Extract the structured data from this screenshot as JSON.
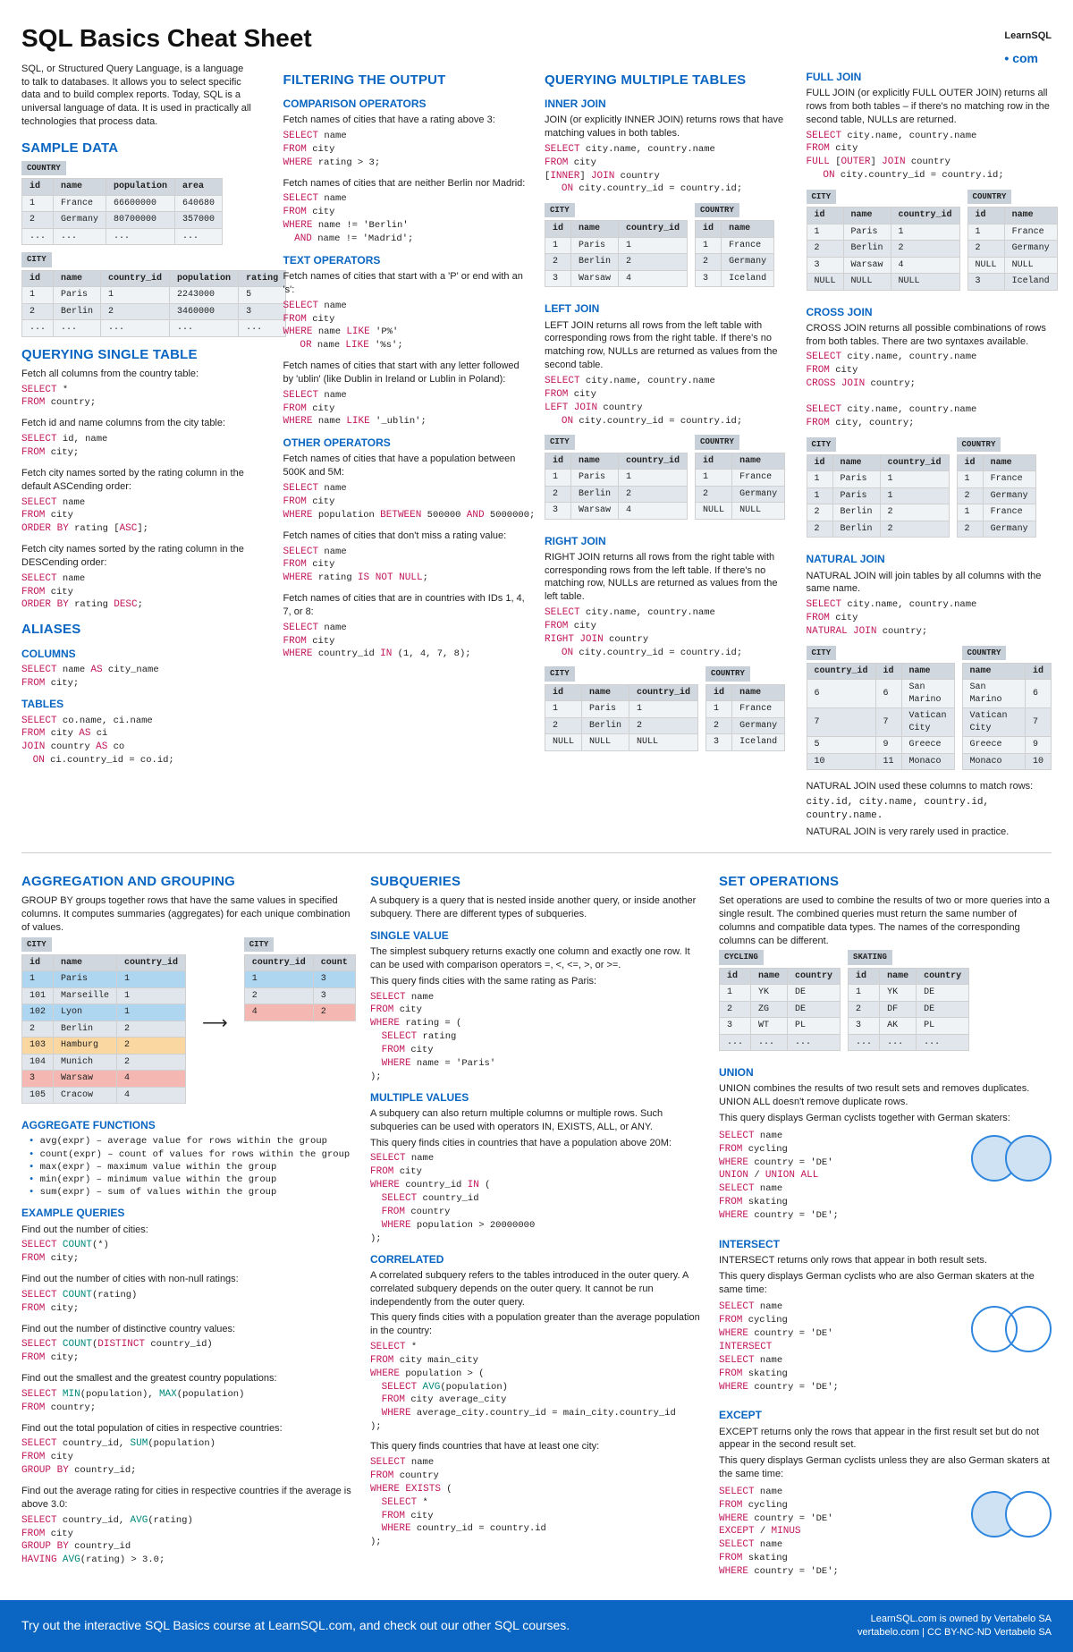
{
  "title": "SQL Basics Cheat Sheet",
  "logo": {
    "brand": "LearnSQL",
    "suffix": "• com"
  },
  "intro": "SQL, or Structured Query Language, is a language to talk to databases. It allows you to select specific data and to build complex reports. Today, SQL is a universal language of data. It is used in practically all technologies that process data.",
  "sample": {
    "h": "SAMPLE DATA",
    "country": {
      "label": "COUNTRY",
      "head": [
        "id",
        "name",
        "population",
        "area"
      ],
      "rows": [
        [
          "1",
          "France",
          "66600000",
          "640680"
        ],
        [
          "2",
          "Germany",
          "80700000",
          "357000"
        ],
        [
          "...",
          "...",
          "...",
          "..."
        ]
      ]
    },
    "city": {
      "label": "CITY",
      "head": [
        "id",
        "name",
        "country_id",
        "population",
        "rating"
      ],
      "rows": [
        [
          "1",
          "Paris",
          "1",
          "2243000",
          "5"
        ],
        [
          "2",
          "Berlin",
          "2",
          "3460000",
          "3"
        ],
        [
          "...",
          "...",
          "...",
          "...",
          "..."
        ]
      ]
    }
  },
  "single": {
    "h": "QUERYING SINGLE TABLE",
    "t1": "Fetch all columns from the country table:",
    "c1": "SELECT *\nFROM country;",
    "t2": "Fetch id and name columns from the city table:",
    "c2": "SELECT id, name\nFROM city;",
    "t3": "Fetch city names sorted by the rating column in the default ASCending order:",
    "c3": "SELECT name\nFROM city\nORDER BY rating [ASC];",
    "t4": "Fetch city names sorted by the rating column in the DESCending order:",
    "c4": "SELECT name\nFROM city\nORDER BY rating DESC;"
  },
  "aliases": {
    "h": "ALIASES",
    "h_cols": "COLUMNS",
    "c1": "SELECT name AS city_name\nFROM city;",
    "h_tab": "TABLES",
    "c2": "SELECT co.name, ci.name\nFROM city AS ci\nJOIN country AS co\n  ON ci.country_id = co.id;"
  },
  "filter": {
    "h": "FILTERING THE OUTPUT",
    "h_comp": "COMPARISON OPERATORS",
    "t1": "Fetch names of cities that have a rating above 3:",
    "c1": "SELECT name\nFROM city\nWHERE rating > 3;",
    "t2": "Fetch names of cities that are neither Berlin nor Madrid:",
    "c2": "SELECT name\nFROM city\nWHERE name != 'Berlin'\n  AND name != 'Madrid';",
    "h_text": "TEXT OPERATORS",
    "t3": "Fetch names of cities that start with a 'P' or end with an 's':",
    "c3": "SELECT name\nFROM city\nWHERE name LIKE 'P%'\n   OR name LIKE '%s';",
    "t4": "Fetch names of cities that start with any letter followed by 'ublin' (like Dublin in Ireland or Lublin in Poland):",
    "c4": "SELECT name\nFROM city\nWHERE name LIKE '_ublin';",
    "h_other": "OTHER OPERATORS",
    "t5": "Fetch names of cities that have a population between 500K and 5M:",
    "c5": "SELECT name\nFROM city\nWHERE population BETWEEN 500000 AND 5000000;",
    "t6": "Fetch names of cities that don't miss a rating value:",
    "c6": "SELECT name\nFROM city\nWHERE rating IS NOT NULL;",
    "t7": "Fetch names of cities that are in countries with IDs 1, 4, 7, or 8:",
    "c7": "SELECT name\nFROM city\nWHERE country_id IN (1, 4, 7, 8);"
  },
  "multi": {
    "h": "QUERYING MULTIPLE TABLES",
    "inner": {
      "h": "INNER JOIN",
      "t": "JOIN (or explicitly INNER JOIN) returns rows that have matching values in both tables.",
      "c": "SELECT city.name, country.name\nFROM city\n[INNER] JOIN country\n   ON city.country_id = country.id;",
      "tbl1": {
        "label": "CITY",
        "head": [
          "id",
          "name",
          "country_id"
        ],
        "rows": [
          [
            "1",
            "Paris",
            "1"
          ],
          [
            "2",
            "Berlin",
            "2"
          ],
          [
            "3",
            "Warsaw",
            "4"
          ]
        ]
      },
      "tbl2": {
        "label": "COUNTRY",
        "head": [
          "id",
          "name"
        ],
        "rows": [
          [
            "1",
            "France"
          ],
          [
            "2",
            "Germany"
          ],
          [
            "3",
            "Iceland"
          ]
        ]
      }
    },
    "left": {
      "h": "LEFT JOIN",
      "t": "LEFT JOIN returns all rows from the left table with corresponding rows from the right table. If there's no matching row, NULLs are returned as values from the second table.",
      "c": "SELECT city.name, country.name\nFROM city\nLEFT JOIN country\n   ON city.country_id = country.id;",
      "tbl1": {
        "label": "CITY",
        "head": [
          "id",
          "name",
          "country_id"
        ],
        "rows": [
          [
            "1",
            "Paris",
            "1"
          ],
          [
            "2",
            "Berlin",
            "2"
          ],
          [
            "3",
            "Warsaw",
            "4"
          ]
        ]
      },
      "tbl2": {
        "label": "COUNTRY",
        "head": [
          "id",
          "name"
        ],
        "rows": [
          [
            "1",
            "France"
          ],
          [
            "2",
            "Germany"
          ],
          [
            "NULL",
            "NULL"
          ]
        ]
      }
    },
    "right": {
      "h": "RIGHT JOIN",
      "t": "RIGHT JOIN returns all rows from the right table with corresponding rows from the left table. If there's no matching row, NULLs are returned as values from the left table.",
      "c": "SELECT city.name, country.name\nFROM city\nRIGHT JOIN country\n   ON city.country_id = country.id;",
      "tbl1": {
        "label": "CITY",
        "head": [
          "id",
          "name",
          "country_id"
        ],
        "rows": [
          [
            "1",
            "Paris",
            "1"
          ],
          [
            "2",
            "Berlin",
            "2"
          ],
          [
            "NULL",
            "NULL",
            "NULL"
          ]
        ]
      },
      "tbl2": {
        "label": "COUNTRY",
        "head": [
          "id",
          "name"
        ],
        "rows": [
          [
            "1",
            "France"
          ],
          [
            "2",
            "Germany"
          ],
          [
            "3",
            "Iceland"
          ]
        ]
      }
    }
  },
  "joins2": {
    "full": {
      "h": "FULL JOIN",
      "t": "FULL JOIN (or explicitly FULL OUTER JOIN) returns all rows from both tables – if there's no matching row in the second table, NULLs are returned.",
      "c": "SELECT city.name, country.name\nFROM city\nFULL [OUTER] JOIN country\n   ON city.country_id = country.id;",
      "tbl1": {
        "label": "CITY",
        "head": [
          "id",
          "name",
          "country_id"
        ],
        "rows": [
          [
            "1",
            "Paris",
            "1"
          ],
          [
            "2",
            "Berlin",
            "2"
          ],
          [
            "3",
            "Warsaw",
            "4"
          ],
          [
            "NULL",
            "NULL",
            "NULL"
          ]
        ]
      },
      "tbl2": {
        "label": "COUNTRY",
        "head": [
          "id",
          "name"
        ],
        "rows": [
          [
            "1",
            "France"
          ],
          [
            "2",
            "Germany"
          ],
          [
            "NULL",
            "NULL"
          ],
          [
            "3",
            "Iceland"
          ]
        ]
      }
    },
    "cross": {
      "h": "CROSS JOIN",
      "t": "CROSS JOIN returns all possible combinations of rows from both tables. There are two syntaxes available.",
      "c": "SELECT city.name, country.name\nFROM city\nCROSS JOIN country;\n\nSELECT city.name, country.name\nFROM city, country;",
      "tbl1": {
        "label": "CITY",
        "head": [
          "id",
          "name",
          "country_id"
        ],
        "rows": [
          [
            "1",
            "Paris",
            "1"
          ],
          [
            "1",
            "Paris",
            "1"
          ],
          [
            "2",
            "Berlin",
            "2"
          ],
          [
            "2",
            "Berlin",
            "2"
          ]
        ]
      },
      "tbl2": {
        "label": "COUNTRY",
        "head": [
          "id",
          "name"
        ],
        "rows": [
          [
            "1",
            "France"
          ],
          [
            "2",
            "Germany"
          ],
          [
            "1",
            "France"
          ],
          [
            "2",
            "Germany"
          ]
        ]
      }
    },
    "natural": {
      "h": "NATURAL JOIN",
      "t": "NATURAL JOIN will join tables by all columns with the same name.",
      "c": "SELECT city.name, country.name\nFROM city\nNATURAL JOIN country;",
      "tbl1": {
        "label": "CITY",
        "head": [
          "country_id",
          "id",
          "name"
        ],
        "rows": [
          [
            "6",
            "6",
            "San Marino"
          ],
          [
            "7",
            "7",
            "Vatican City"
          ],
          [
            "5",
            "9",
            "Greece"
          ],
          [
            "10",
            "11",
            "Monaco"
          ]
        ]
      },
      "tbl2": {
        "label": "COUNTRY",
        "head": [
          "name",
          "id"
        ],
        "rows": [
          [
            "San Marino",
            "6"
          ],
          [
            "Vatican City",
            "7"
          ],
          [
            "Greece",
            "9"
          ],
          [
            "Monaco",
            "10"
          ]
        ]
      },
      "note1": "NATURAL JOIN used these columns to match rows:",
      "note2": "city.id, city.name, country.id, country.name.",
      "note3": "NATURAL JOIN is very rarely used in practice."
    }
  },
  "agg": {
    "h": "AGGREGATION AND GROUPING",
    "t": "GROUP BY groups together rows that have the same values in specified columns. It computes summaries (aggregates) for each unique combination of values.",
    "tbl1": {
      "label": "CITY",
      "head": [
        "id",
        "name",
        "country_id"
      ],
      "rows": [
        [
          "1",
          "Paris",
          "1"
        ],
        [
          "101",
          "Marseille",
          "1"
        ],
        [
          "102",
          "Lyon",
          "1"
        ],
        [
          "2",
          "Berlin",
          "2"
        ],
        [
          "103",
          "Hamburg",
          "2"
        ],
        [
          "104",
          "Munich",
          "2"
        ],
        [
          "3",
          "Warsaw",
          "4"
        ],
        [
          "105",
          "Cracow",
          "4"
        ]
      ]
    },
    "tbl2": {
      "label": "CITY",
      "head": [
        "country_id",
        "count"
      ],
      "rows": [
        [
          "1",
          "3"
        ],
        [
          "2",
          "3"
        ],
        [
          "4",
          "2"
        ]
      ]
    },
    "h_fn": "AGGREGATE FUNCTIONS",
    "fns": [
      "avg(expr) – average value for rows within the group",
      "count(expr) – count of values for rows within the group",
      "max(expr) – maximum value within the group",
      "min(expr) – minimum value within the group",
      "sum(expr) – sum of values within the group"
    ],
    "h_ex": "EXAMPLE QUERIES",
    "e1t": "Find out the number of cities:",
    "e1c": "SELECT COUNT(*)\nFROM city;",
    "e2t": "Find out the number of cities with non-null ratings:",
    "e2c": "SELECT COUNT(rating)\nFROM city;",
    "e3t": "Find out the number of distinctive country values:",
    "e3c": "SELECT COUNT(DISTINCT country_id)\nFROM city;",
    "e4t": "Find out the smallest and the greatest country populations:",
    "e4c": "SELECT MIN(population), MAX(population)\nFROM country;",
    "e5t": "Find out the total population of cities in respective countries:",
    "e5c": "SELECT country_id, SUM(population)\nFROM city\nGROUP BY country_id;",
    "e6t": "Find out the average rating for cities in respective countries if the average is above 3.0:",
    "e6c": "SELECT country_id, AVG(rating)\nFROM city\nGROUP BY country_id\nHAVING AVG(rating) > 3.0;"
  },
  "subq": {
    "h": "SUBQUERIES",
    "t": "A subquery is a query that is nested inside another query, or inside another subquery. There are different types of subqueries.",
    "sv": {
      "h": "SINGLE VALUE",
      "t": "The simplest subquery returns exactly one column and exactly one row. It can be used with comparison operators =, <, <=, >, or >=.",
      "t2": "This query finds cities with the same rating as Paris:",
      "c": "SELECT name\nFROM city\nWHERE rating = (\n  SELECT rating\n  FROM city\n  WHERE name = 'Paris'\n);"
    },
    "mv": {
      "h": "MULTIPLE VALUES",
      "t": "A subquery can also return multiple columns or multiple rows. Such subqueries can be used with operators IN, EXISTS, ALL, or ANY.",
      "t2": "This query finds cities in countries that have a population above 20M:",
      "c": "SELECT name\nFROM city\nWHERE country_id IN (\n  SELECT country_id\n  FROM country\n  WHERE population > 20000000\n);"
    },
    "co": {
      "h": "CORRELATED",
      "t": "A correlated subquery refers to the tables introduced in the outer query. A correlated subquery depends on the outer query. It cannot be run independently from the outer query.",
      "t2": "This query finds cities with a population greater than the average population in the country:",
      "c": "SELECT *\nFROM city main_city\nWHERE population > (\n  SELECT AVG(population)\n  FROM city average_city\n  WHERE average_city.country_id = main_city.country_id\n);",
      "t3": "This query finds countries that have at least one city:",
      "c2": "SELECT name\nFROM country\nWHERE EXISTS (\n  SELECT *\n  FROM city\n  WHERE country_id = country.id\n);"
    }
  },
  "setops": {
    "h": "SET OPERATIONS",
    "t": "Set operations are used to combine the results of two or more queries into a single result. The combined queries must return the same number of columns and compatible data types. The names of the corresponding columns can be different.",
    "cyc": {
      "label": "CYCLING",
      "head": [
        "id",
        "name",
        "country"
      ],
      "rows": [
        [
          "1",
          "YK",
          "DE"
        ],
        [
          "2",
          "ZG",
          "DE"
        ],
        [
          "3",
          "WT",
          "PL"
        ],
        [
          "...",
          "...",
          "..."
        ]
      ]
    },
    "ska": {
      "label": "SKATING",
      "head": [
        "id",
        "name",
        "country"
      ],
      "rows": [
        [
          "1",
          "YK",
          "DE"
        ],
        [
          "2",
          "DF",
          "DE"
        ],
        [
          "3",
          "AK",
          "PL"
        ],
        [
          "...",
          "...",
          "..."
        ]
      ]
    },
    "union": {
      "h": "UNION",
      "t": "UNION combines the results of two result sets and removes duplicates. UNION ALL doesn't remove duplicate rows.",
      "t2": "This query displays German cyclists together with German skaters:",
      "c": "SELECT name\nFROM cycling\nWHERE country = 'DE'\nUNION / UNION ALL\nSELECT name\nFROM skating\nWHERE country = 'DE';"
    },
    "intersect": {
      "h": "INTERSECT",
      "t": "INTERSECT returns only rows that appear in both result sets.",
      "t2": "This query displays German cyclists who are also German skaters at the same time:",
      "c": "SELECT name\nFROM cycling\nWHERE country = 'DE'\nINTERSECT\nSELECT name\nFROM skating\nWHERE country = 'DE';"
    },
    "except": {
      "h": "EXCEPT",
      "t": "EXCEPT returns only the rows that appear in the first result set but do not appear in the second result set.",
      "t2": "This query displays German cyclists unless they are also German skaters at the same time:",
      "c": "SELECT name\nFROM cycling\nWHERE country = 'DE'\nEXCEPT / MINUS\nSELECT name\nFROM skating\nWHERE country = 'DE';"
    }
  },
  "footer": {
    "txt": "Try out the interactive SQL Basics course at LearnSQL.com, and check out our other SQL courses.",
    "r1": "LearnSQL.com is owned by Vertabelo SA",
    "r2": "vertabelo.com | CC BY-NC-ND Vertabelo SA"
  }
}
